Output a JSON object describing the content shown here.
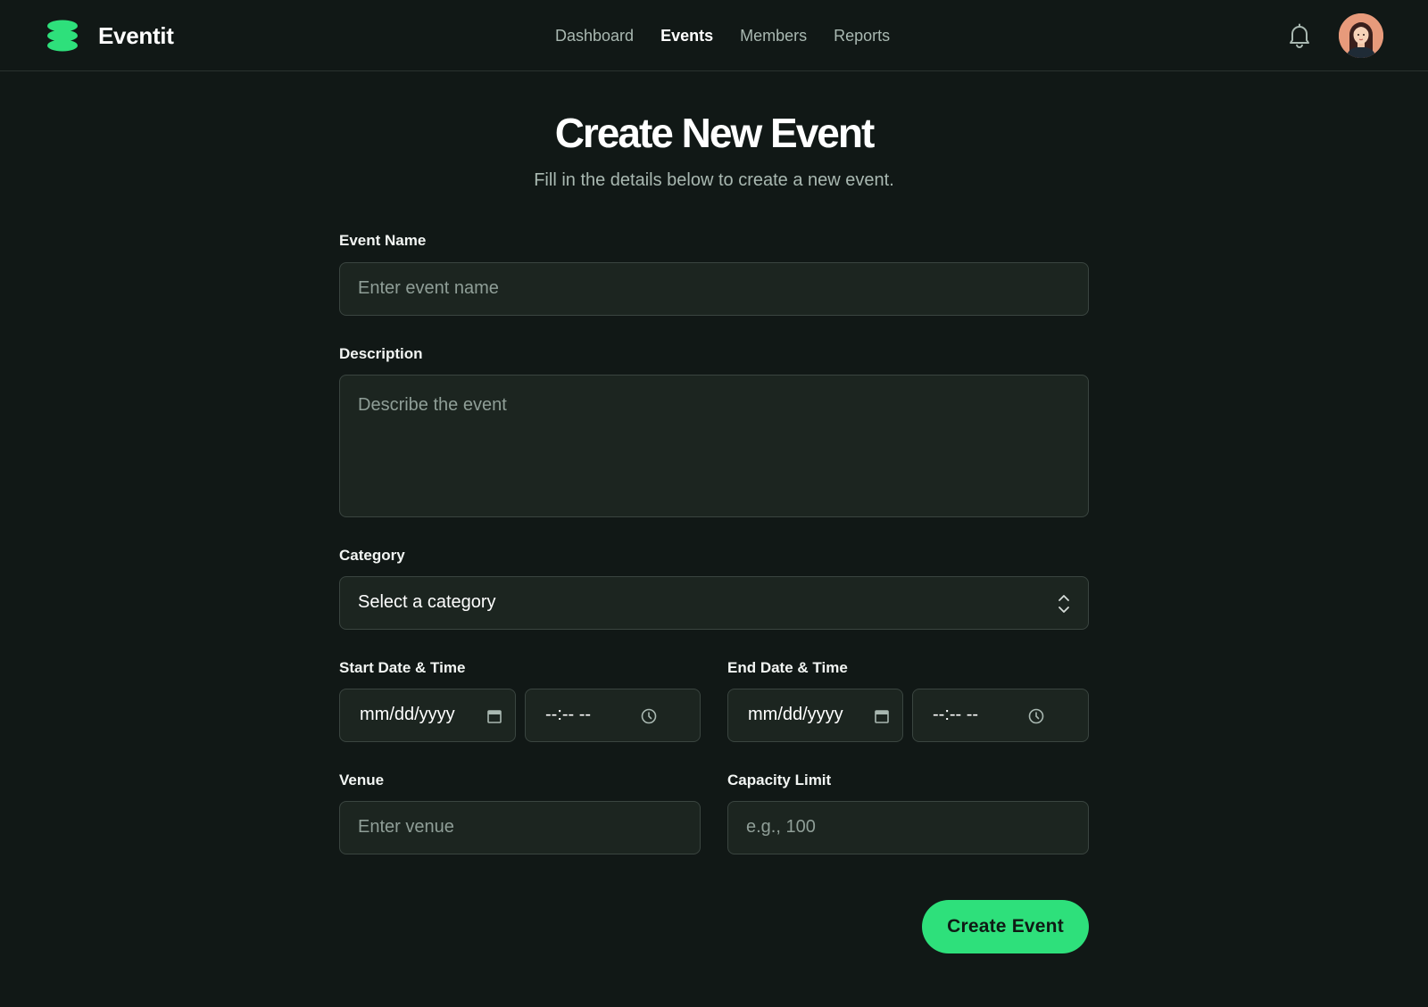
{
  "app": {
    "brand": "Eventit"
  },
  "nav": {
    "items": [
      {
        "label": "Dashboard",
        "active": false
      },
      {
        "label": "Events",
        "active": true
      },
      {
        "label": "Members",
        "active": false
      },
      {
        "label": "Reports",
        "active": false
      }
    ]
  },
  "header": {
    "notification_icon": "bell-icon",
    "avatar_icon": "user-avatar"
  },
  "page": {
    "title": "Create New Event",
    "subtitle": "Fill in the details below to create a new event."
  },
  "form": {
    "event_name": {
      "label": "Event Name",
      "placeholder": "Enter event name"
    },
    "description": {
      "label": "Description",
      "placeholder": "Describe the event"
    },
    "category": {
      "label": "Category",
      "value": "Select a category"
    },
    "start": {
      "label": "Start Date & Time",
      "date": "mm/dd/yyyy",
      "time": "--:-- --"
    },
    "end": {
      "label": "End Date & Time",
      "date": "mm/dd/yyyy",
      "time": "--:-- --"
    },
    "venue": {
      "label": "Venue",
      "placeholder": "Enter venue"
    },
    "capacity": {
      "label": "Capacity Limit",
      "placeholder": "e.g., 100"
    },
    "submit_label": "Create Event"
  },
  "colors": {
    "accent": "#2ee07b",
    "background": "#111816",
    "field_bg": "#1c2520"
  }
}
